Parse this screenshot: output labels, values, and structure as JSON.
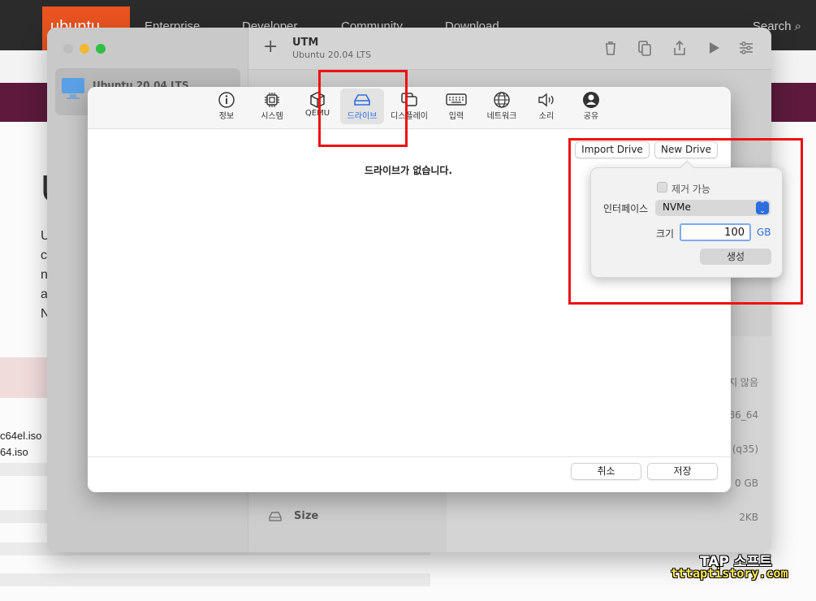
{
  "website": {
    "logo": "ubuntu",
    "nav": [
      "Enterprise",
      "Developer",
      "Community",
      "Download"
    ],
    "search_label": "Search",
    "big_letter": "U",
    "side_letters": [
      "U",
      "c",
      "n",
      "a",
      "N"
    ],
    "files": [
      "c64el.iso",
      "64.iso"
    ]
  },
  "utm_window": {
    "title": "UTM",
    "subtitle": "Ubuntu 20.04 LTS",
    "sidebar_vm_name": "Ubuntu 20.04 LTS",
    "toolbar_icons": [
      "trash-icon",
      "clone-icon",
      "share-icon",
      "play-icon",
      "settings-icon"
    ],
    "right_values": [
      "지 않음",
      "86_64",
      "(q35)",
      "0 GB",
      "2KB"
    ],
    "size_row_label": "Size"
  },
  "settings_sheet": {
    "tabs": [
      {
        "label": "정보",
        "icon": "info-icon"
      },
      {
        "label": "시스템",
        "icon": "cpu-icon"
      },
      {
        "label": "QEMU",
        "icon": "cube-icon"
      },
      {
        "label": "드라이브",
        "icon": "drive-icon",
        "selected": true
      },
      {
        "label": "디스플레이",
        "icon": "display-icon"
      },
      {
        "label": "입력",
        "icon": "keyboard-icon"
      },
      {
        "label": "네트워크",
        "icon": "globe-icon"
      },
      {
        "label": "소리",
        "icon": "speaker-icon"
      },
      {
        "label": "공유",
        "icon": "person-icon"
      }
    ],
    "empty_message": "드라이브가 없습니다.",
    "import_drive": "Import Drive",
    "new_drive": "New Drive",
    "cancel": "취소",
    "save": "저장"
  },
  "new_drive_popover": {
    "removable_label": "제거 가능",
    "removable_checked": false,
    "interface_label": "인터페이스",
    "interface_value": "NVMe",
    "size_label": "크기",
    "size_value": "100",
    "size_unit": "GB",
    "create_button": "생성"
  },
  "watermark": {
    "line1": "TAP 소프트",
    "line2": "tttaptistory.com"
  },
  "colors": {
    "accent": "#2b6fe0",
    "annotation": "#ee1111",
    "ubuntu_orange": "#e95420"
  }
}
